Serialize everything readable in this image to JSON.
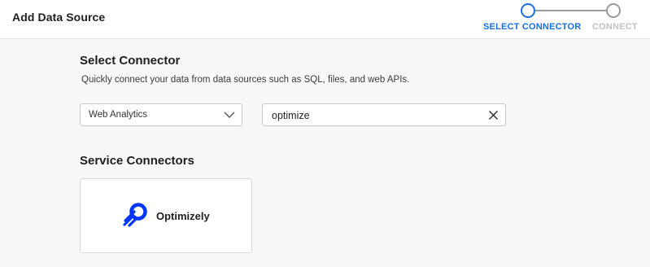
{
  "header": {
    "title": "Add Data Source"
  },
  "stepper": {
    "steps": [
      {
        "label": "SELECT CONNECTOR",
        "state": "active"
      },
      {
        "label": "CONNECT",
        "state": "inactive"
      }
    ],
    "active_color": "#1a6fe0",
    "inactive_color": "#9a9a9a"
  },
  "select_connector": {
    "title": "Select Connector",
    "description": "Quickly connect your data from data sources such as SQL, files, and web APIs.",
    "category_select": {
      "value": "Web Analytics",
      "icon": "chevron-down-icon"
    },
    "search": {
      "value": "optimize",
      "clear_icon": "close-icon"
    }
  },
  "service_connectors": {
    "title": "Service Connectors",
    "items": [
      {
        "label": "Optimizely",
        "icon": "optimizely-logo",
        "brand_color": "#0037ff"
      }
    ]
  }
}
